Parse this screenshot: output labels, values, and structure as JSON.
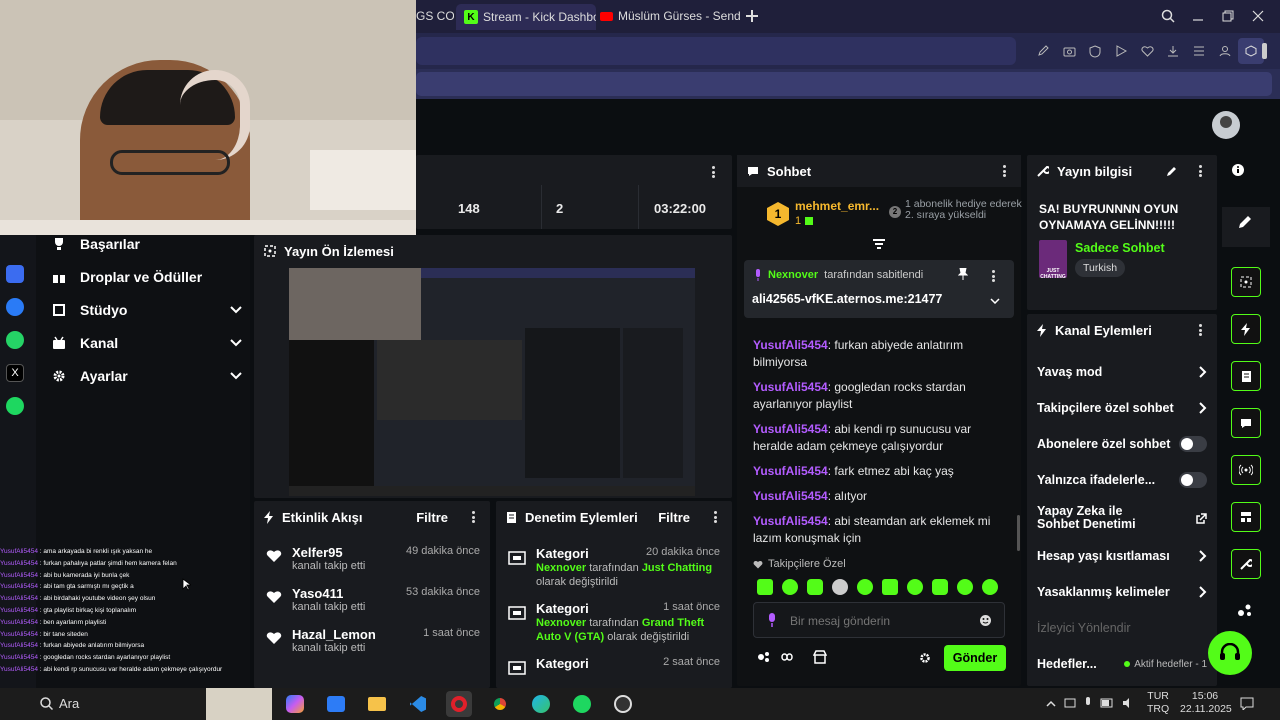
{
  "browser": {
    "tabs": [
      {
        "label": "GS COG",
        "favicon_color": "#d33"
      },
      {
        "label": "Stream - Kick Dashboard",
        "favicon_color": "#53fc18",
        "active": true
      },
      {
        "label": "Müslüm Gürses - Senden Vaz",
        "favicon_color": "#ff0000"
      }
    ]
  },
  "stats": {
    "viewers": "148",
    "followers": "2",
    "uptime": "03:22:00"
  },
  "sidebar": {
    "items": [
      {
        "label": "Başarılar",
        "icon": "trophy-icon"
      },
      {
        "label": "Droplar ve Ödüller",
        "icon": "gift-icon"
      },
      {
        "label": "Stüdyo",
        "icon": "studio-icon",
        "expandable": true
      },
      {
        "label": "Kanal",
        "icon": "channel-icon",
        "expandable": true
      },
      {
        "label": "Ayarlar",
        "icon": "gear-icon",
        "expandable": true
      }
    ]
  },
  "preview": {
    "title": "Yayın Ön İzlemesi"
  },
  "activity": {
    "title": "Etkinlik Akışı",
    "filter": "Filtre",
    "events": [
      {
        "user": "Xelfer95",
        "action": "kanalı takip etti",
        "time": "49 dakika önce"
      },
      {
        "user": "Yaso411",
        "action": "kanalı takip etti",
        "time": "53 dakika önce"
      },
      {
        "user": "Hazal_Lemon",
        "action": "kanalı takip etti",
        "time": "1 saat önce"
      }
    ]
  },
  "moderation_log": {
    "title": "Denetim Eylemleri",
    "filter": "Filtre",
    "entries": [
      {
        "kind": "Kategori",
        "time": "20 dakika önce",
        "actor": "Nexnover",
        "by": "tarafından",
        "target": "Just Chatting",
        "suffix": "olarak değiştirildi"
      },
      {
        "kind": "Kategori",
        "time": "1 saat önce",
        "actor": "Nexnover",
        "by": "tarafından",
        "target": "Grand Theft Auto V (GTA)",
        "suffix": "olarak değiştirildi"
      },
      {
        "kind": "Kategori",
        "time": "2 saat önce"
      }
    ]
  },
  "chat": {
    "title": "Sohbet",
    "gifter": {
      "badge": "1",
      "name": "mehmet_emr...",
      "count": "1",
      "gift_badge": "2",
      "text": "1 abonelik hediye ederek 2. sıraya yükseldi"
    },
    "pinned": {
      "by_user": "Nexnover",
      "by_text": "tarafından sabitlendi",
      "message": "ali42565-vfKE.aternos.me:21477"
    },
    "messages": [
      {
        "user": "YusufAli5454",
        "text": "furkan abiyede anlatırım bilmiyorsa"
      },
      {
        "user": "YusufAli5454",
        "text": "googledan rocks stardan ayarlanıyor playlist"
      },
      {
        "user": "YusufAli5454",
        "text": "abi kendi rp sunucusu var heralde adam çekmeye çalışıyordur"
      },
      {
        "user": "YusufAli5454",
        "text": "fark etmez abi kaç yaş"
      },
      {
        "user": "YusufAli5454",
        "text": "alıtyor"
      },
      {
        "user": "YusufAli5454",
        "text": "abi steamdan ark eklemek mi lazım konuşmak için"
      }
    ],
    "followers_only": "Takipçilere Özel",
    "input_placeholder": "Bir mesaj gönderin",
    "send": "Gönder"
  },
  "stream_info": {
    "title": "Yayın bilgisi",
    "stream_title": "SA! BUYRUNNNN OYUN OYNAMAYA GELİNN!!!!!",
    "category": "Sadece Sohbet",
    "language": "Turkish",
    "thumb_label": "JUST CHATTING"
  },
  "channel_actions": {
    "title": "Kanal Eylemleri",
    "rows": [
      {
        "label": "Yavaş mod",
        "control": "chevron"
      },
      {
        "label": "Takipçilere özel sohbet",
        "control": "chevron"
      },
      {
        "label": "Abonelere özel sohbet",
        "control": "toggle"
      },
      {
        "label": "Yalnızca ifadelerle...",
        "control": "toggle"
      },
      {
        "label": "Yapay Zeka ile Sohbet Denetimi",
        "control": "external"
      },
      {
        "label": "Hesap yaşı kısıtlaması",
        "control": "chevron"
      },
      {
        "label": "Yasaklanmış kelimeler",
        "control": "chevron"
      }
    ],
    "redirect": "İzleyici Yönlendir",
    "goals": "Hedefler...",
    "goals_status": "Aktif hedefler - 1"
  },
  "overlay_chat": [
    {
      "user": "YusufAli5454",
      "text": "ama arkayada bi renkli ışık yaksan he"
    },
    {
      "user": "YusufAli5454",
      "text": "furkan pahalıya patlar şimdi hem kamera felan"
    },
    {
      "user": "YusufAli5454",
      "text": "abi bu kamerada iyi bunla çek"
    },
    {
      "user": "YusufAli5454",
      "text": "abi tam gta sarmıştı mı geçtik a"
    },
    {
      "user": "YusufAli5454",
      "text": "abi birdahaki youtube videon şey olsun"
    },
    {
      "user": "YusufAli5454",
      "text": "gta playlist birkaç kişi toplanalım"
    },
    {
      "user": "YusufAli5454",
      "text": "ben ayarlarım playlisti"
    },
    {
      "user": "YusufAli5454",
      "text": "bir tane siteden"
    },
    {
      "user": "YusufAli5454",
      "text": "furkan abiyede anlatırım bilmiyorsa"
    },
    {
      "user": "YusufAli5454",
      "text": "googledan rocks stardan ayarlanıyor playlist"
    },
    {
      "user": "YusufAli5454",
      "text": "abi kendi rp sunucusu var heralde adam çekmeye çalışıyordur"
    }
  ],
  "taskbar": {
    "search": "Ara",
    "lang": "TUR",
    "lang2": "TRQ",
    "time": "15:06",
    "date": "22.11.2025"
  },
  "colors": {
    "kick_green": "#53fc18",
    "panel": "#191b1f",
    "chat_user": "#b35cff"
  }
}
